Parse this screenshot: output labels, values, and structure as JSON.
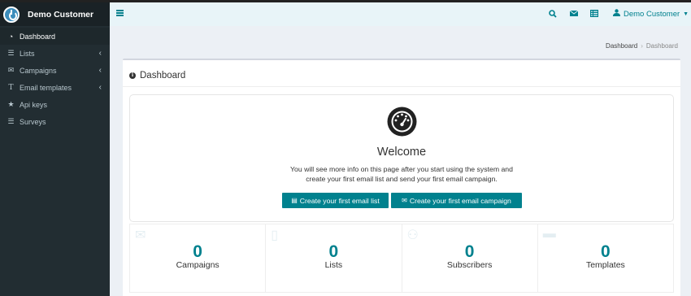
{
  "brand": {
    "name": "Demo Customer"
  },
  "sidebar": {
    "items": [
      {
        "label": "Dashboard",
        "icon": "dashboard-icon",
        "active": true
      },
      {
        "label": "Lists",
        "icon": "list-icon",
        "chevron": true
      },
      {
        "label": "Campaigns",
        "icon": "envelope-icon",
        "chevron": true
      },
      {
        "label": "Email templates",
        "icon": "text-icon",
        "chevron": true
      },
      {
        "label": "Api keys",
        "icon": "star-icon"
      },
      {
        "label": "Surveys",
        "icon": "list-icon"
      }
    ]
  },
  "header": {
    "user_name": "Demo Customer"
  },
  "breadcrumb": {
    "home": "Dashboard",
    "current": "Dashboard"
  },
  "box": {
    "title": "Dashboard"
  },
  "welcome": {
    "title": "Welcome",
    "line1": "You will see more info on this page after you start using the system and",
    "line2": "create your first email list and send your first email campaign.",
    "btn_list": "Create your first email list",
    "btn_campaign": "Create your first email campaign"
  },
  "stats": [
    {
      "value": "0",
      "label": "Campaigns",
      "icon": "envelope-icon"
    },
    {
      "value": "0",
      "label": "Lists",
      "icon": "document-icon"
    },
    {
      "value": "0",
      "label": "Subscribers",
      "icon": "users-icon"
    },
    {
      "value": "0",
      "label": "Templates",
      "icon": "template-icon"
    }
  ],
  "colors": {
    "accent": "#00818e",
    "sidebar": "#222d32",
    "header": "#e8f4f8"
  }
}
